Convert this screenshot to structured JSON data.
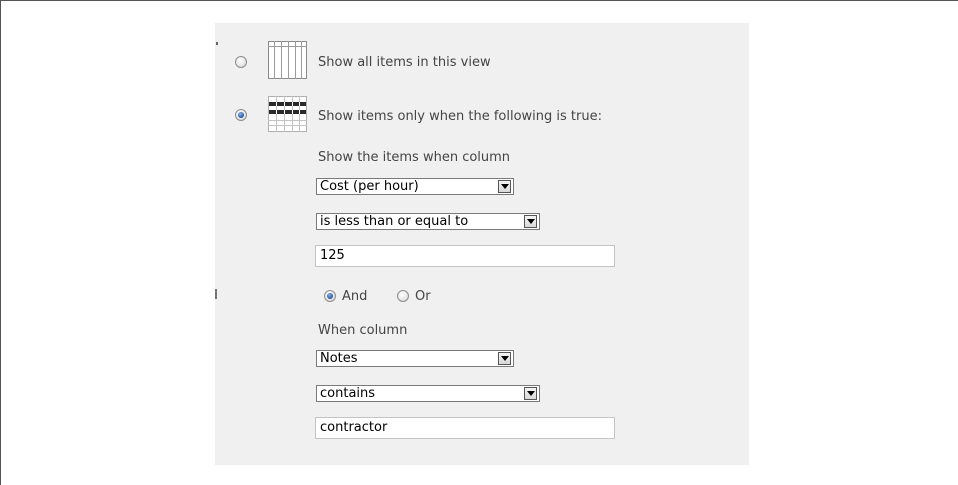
{
  "filter": {
    "show_all_label": "Show all items in this view",
    "show_filtered_label": "Show items only when the following is true:",
    "column_prompt": "Show the items when column",
    "first_condition": {
      "column": "Cost (per hour)",
      "operator": "is less than or equal to",
      "value": "125"
    },
    "logic": {
      "and_label": "And",
      "or_label": "Or",
      "selected": "And"
    },
    "second_prompt": "When column",
    "second_condition": {
      "column": "Notes",
      "operator": "contains",
      "value": "contractor"
    }
  },
  "icons": {
    "show_all": "grid-table-icon",
    "show_filtered": "filtered-table-icon"
  },
  "colors": {
    "panel": "#f0f0f0",
    "radio_selected": "#2d5fae"
  }
}
